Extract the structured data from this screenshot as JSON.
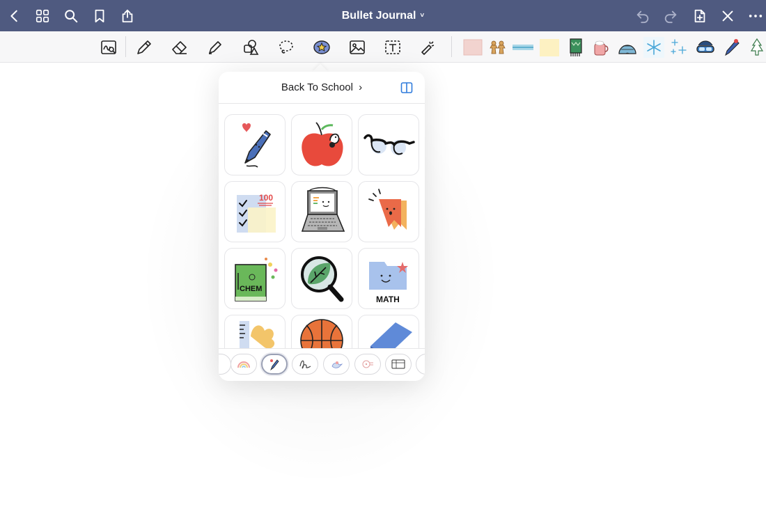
{
  "header": {
    "title": "Bullet Journal",
    "title_chevron": "˅",
    "left_icons": [
      "back-chevron-icon",
      "grid-icon",
      "search-icon",
      "bookmark-icon",
      "share-icon"
    ],
    "right_icons": [
      "undo-icon",
      "redo-icon",
      "add-page-icon",
      "close-icon",
      "more-icon"
    ]
  },
  "toolbar": {
    "tools": [
      "zoom-lasso-icon",
      "pen-icon",
      "eraser-icon",
      "highlighter-icon",
      "shapes-icon",
      "lasso-icon",
      "sticker-icon",
      "image-icon",
      "text-icon",
      "laser-pointer-icon"
    ],
    "active_tool": "sticker-icon",
    "recent_stickers": [
      "pink-paper-sticker",
      "gingerbread-sticker",
      "blue-tape-sticker",
      "yellow-note-sticker",
      "green-scarf-sticker",
      "cocoa-mug-sticker",
      "igloo-sticker",
      "snowflake-sticker",
      "snowflakes-sticker",
      "ski-goggles-sticker",
      "blue-pen-sticker",
      "pine-tree-sticker"
    ]
  },
  "sticker_panel": {
    "pack_title": "Back To School",
    "pack_chevron": "›",
    "stickers": [
      {
        "name": "pen-heart-sticker"
      },
      {
        "name": "apple-worm-sticker"
      },
      {
        "name": "glasses-sticker"
      },
      {
        "name": "checklist-100-sticker"
      },
      {
        "name": "laptop-sticker"
      },
      {
        "name": "bookmark-face-sticker"
      },
      {
        "name": "chem-book-sticker",
        "label": "CHEM"
      },
      {
        "name": "magnifier-leaf-sticker"
      },
      {
        "name": "math-folder-sticker",
        "label": "MATH"
      },
      {
        "name": "ruler-leaf-sticker"
      },
      {
        "name": "basketball-sticker"
      },
      {
        "name": "eraser-sticker"
      }
    ],
    "category_tabs": [
      "rainbow-tab",
      "back-to-school-tab",
      "signature-tab",
      "bird-tab",
      "planner-tab",
      "calendar-tab"
    ],
    "active_tab": "back-to-school-tab"
  }
}
